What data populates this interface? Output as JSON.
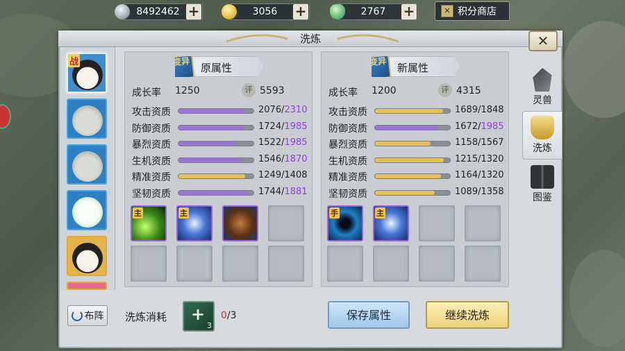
{
  "currencies": [
    {
      "name": "silver-coin",
      "value": "8492462"
    },
    {
      "name": "gold-ingot",
      "value": "3056"
    },
    {
      "name": "jade",
      "value": "2767"
    }
  ],
  "shop_label": "积分商店",
  "title": "洗炼",
  "close_label": "✕",
  "pets": [
    {
      "badge": "战",
      "selected": true
    },
    {
      "badge": "",
      "selected": false
    },
    {
      "badge": "",
      "selected": false
    },
    {
      "badge": "",
      "selected": false
    },
    {
      "badge": "",
      "selected": false
    },
    {
      "badge": "",
      "selected": false
    }
  ],
  "old_attr": {
    "header": "原属性",
    "header_icon": "变异",
    "growth_label": "成长率",
    "growth": "1250",
    "score": "5593",
    "score_icon": "评",
    "stats": [
      {
        "label": "攻击资质",
        "cur": "2076",
        "max": "2310",
        "max_purple": true,
        "pct": 0.9,
        "color": "#9b74d8"
      },
      {
        "label": "防御资质",
        "cur": "1724",
        "max": "1985",
        "max_purple": true,
        "pct": 0.87,
        "color": "#9b74d8"
      },
      {
        "label": "暴烈资质",
        "cur": "1522",
        "max": "1985",
        "max_purple": true,
        "pct": 0.77,
        "color": "#9b74d8"
      },
      {
        "label": "生机资质",
        "cur": "1546",
        "max": "1870",
        "max_purple": true,
        "pct": 0.83,
        "color": "#9b74d8"
      },
      {
        "label": "精准资质",
        "cur": "1249",
        "max": "1408",
        "max_purple": false,
        "pct": 0.89,
        "color": "#e8c05a"
      },
      {
        "label": "坚韧资质",
        "cur": "1744",
        "max": "1881",
        "max_purple": true,
        "pct": 0.93,
        "color": "#9b74d8"
      }
    ],
    "skills": [
      {
        "tag": "主",
        "icon": "green-slash-skill-icon"
      },
      {
        "tag": "主",
        "icon": "blue-orb-skill-icon"
      },
      {
        "tag": "",
        "icon": "brown-fist-skill-icon"
      }
    ]
  },
  "new_attr": {
    "header": "新属性",
    "header_icon": "变异",
    "growth_label": "成长率",
    "growth": "1200",
    "score": "4315",
    "score_icon": "评",
    "stats": [
      {
        "label": "攻击资质",
        "cur": "1689",
        "max": "1848",
        "max_purple": false,
        "pct": 0.91,
        "color": "#e8c05a"
      },
      {
        "label": "防御资质",
        "cur": "1672",
        "max": "1985",
        "max_purple": true,
        "pct": 0.84,
        "color": "#9b74d8"
      },
      {
        "label": "暴烈资质",
        "cur": "1158",
        "max": "1567",
        "max_purple": false,
        "pct": 0.74,
        "color": "#e8c05a"
      },
      {
        "label": "生机资质",
        "cur": "1215",
        "max": "1320",
        "max_purple": false,
        "pct": 0.92,
        "color": "#e8c05a"
      },
      {
        "label": "精准资质",
        "cur": "1164",
        "max": "1320",
        "max_purple": false,
        "pct": 0.88,
        "color": "#e8c05a"
      },
      {
        "label": "坚韧资质",
        "cur": "1089",
        "max": "1358",
        "max_purple": false,
        "pct": 0.8,
        "color": "#e8c05a"
      }
    ],
    "skills": [
      {
        "tag": "手",
        "icon": "dark-vortex-skill-icon"
      },
      {
        "tag": "主",
        "icon": "blue-orb-skill-icon"
      }
    ]
  },
  "tabs": [
    {
      "label": "灵兽",
      "icon": "beast-icon",
      "active": false
    },
    {
      "label": "洗炼",
      "icon": "cauldron-icon",
      "active": true
    },
    {
      "label": "图鉴",
      "icon": "book-icon",
      "active": false
    }
  ],
  "buzhen_label": "布阵",
  "cost_label": "洗炼消耗",
  "cost_item_count": "3",
  "cost_have": "0",
  "cost_need": "/3",
  "save_label": "保存属性",
  "continue_label": "继续洗炼"
}
